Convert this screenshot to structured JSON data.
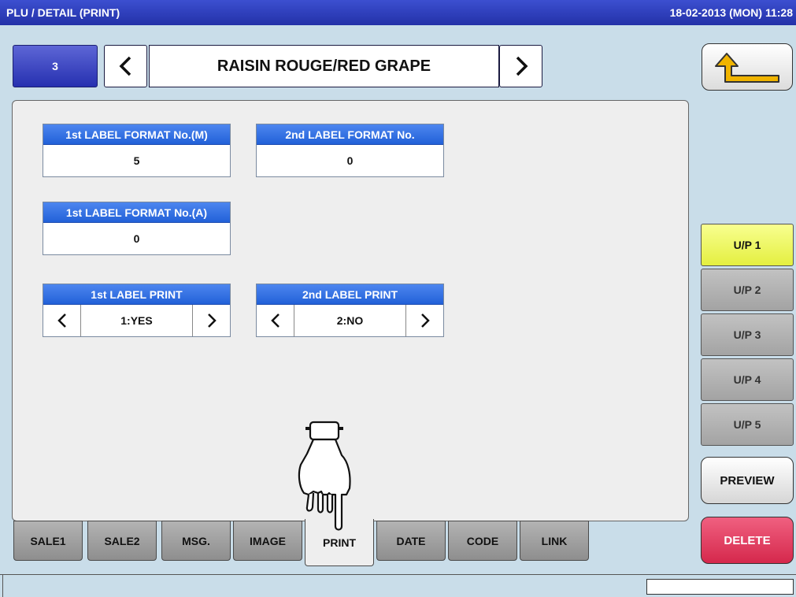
{
  "titlebar": {
    "title": "PLU / DETAIL (PRINT)",
    "datetime": "18-02-2013 (MON) 11:28"
  },
  "plu": {
    "number": "3",
    "name": "RAISIN ROUGE/RED GRAPE"
  },
  "fields": {
    "label_format_m": {
      "label": "1st LABEL FORMAT No.(M)",
      "value": "5"
    },
    "label_format_2nd": {
      "label": "2nd LABEL FORMAT No.",
      "value": "0"
    },
    "label_format_a": {
      "label": "1st LABEL FORMAT No.(A)",
      "value": "0"
    },
    "label_print_1st": {
      "label": "1st LABEL PRINT",
      "value": "1:YES"
    },
    "label_print_2nd": {
      "label": "2nd LABEL PRINT",
      "value": "2:NO"
    }
  },
  "tabs": [
    "SALE1",
    "SALE2",
    "MSG.",
    "IMAGE",
    "PRINT",
    "DATE",
    "CODE",
    "LINK"
  ],
  "active_tab": "PRINT",
  "unit_prices": [
    "U/P 1",
    "U/P 2",
    "U/P 3",
    "U/P 4",
    "U/P 5"
  ],
  "active_unit_price": "U/P 1",
  "buttons": {
    "preview": "PREVIEW",
    "delete": "DELETE"
  },
  "colors": {
    "header_blue": "#2261d8",
    "active_yellow": "#e4ef40",
    "delete_red": "#d5284c"
  }
}
